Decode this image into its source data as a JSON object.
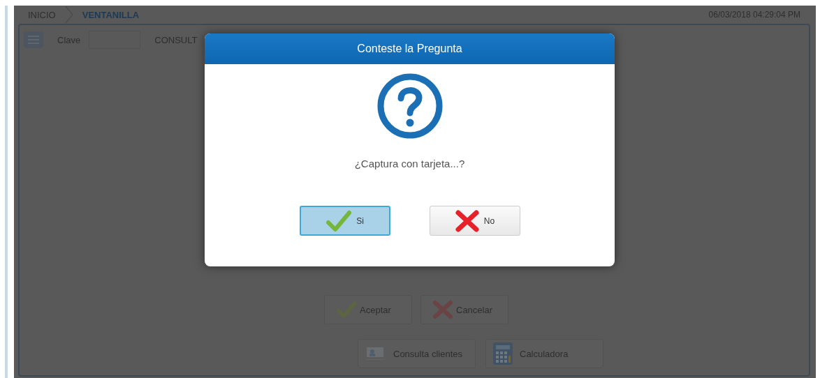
{
  "breadcrumb": [
    {
      "label": "INICIO",
      "current": false
    },
    {
      "label": "VENTANILLA",
      "current": true
    }
  ],
  "datetime": "06/03/2018 04:29:04 PM",
  "form": {
    "key_label": "Clave",
    "section_label": "CONSULT"
  },
  "actions": [
    {
      "label": "Aceptar",
      "kind": "accept"
    },
    {
      "label": "Cancelar",
      "kind": "cancel"
    }
  ],
  "tools": [
    {
      "label": "Consulta clientes",
      "kind": "clients"
    },
    {
      "label": "Calculadora",
      "kind": "calculator"
    }
  ],
  "dialog": {
    "title": "Conteste la Pregunta",
    "message": "¿Captura con tarjeta...?",
    "buttons": [
      {
        "label": "Si",
        "kind": "yes",
        "selected": true
      },
      {
        "label": "No",
        "kind": "no",
        "selected": false
      }
    ]
  }
}
